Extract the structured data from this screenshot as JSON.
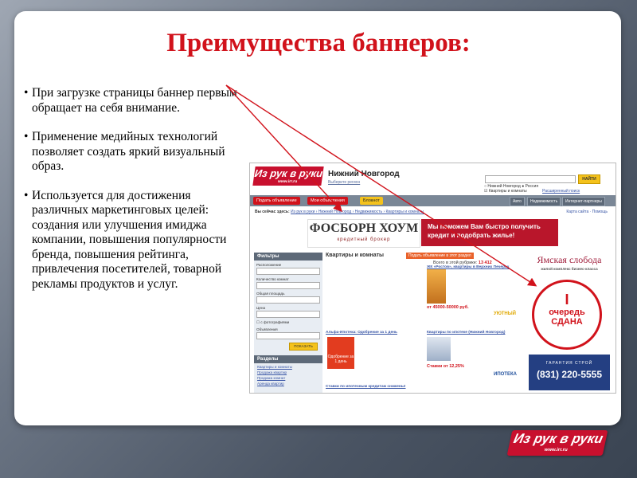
{
  "slide": {
    "title": "Преимущества баннеров:",
    "bullets": [
      {
        "marker": "•",
        "text": "При загрузке страницы баннер первым обращает на себя внимание."
      },
      {
        "marker": "•",
        "text": "Применение медийных технологий позволяет создать яркий визуальный образ."
      },
      {
        "marker": "•",
        "text": "Используется для достижения различных маркетинговых целей: создания или улучшения имиджа компании, повышения популярности бренда, повышения рейтинга, привлечения посетителей, товарной рекламы продуктов и услуг."
      }
    ],
    "footer_logo": {
      "text": "Из рук в руки",
      "url": "www.irr.ru"
    },
    "arrow_color": "#d1121b"
  },
  "screenshot": {
    "logo": {
      "text": "Из рук в руки",
      "url": "www.irr.ru"
    },
    "city": "Нижний Новгород",
    "city_change": "Выберите регион",
    "search": {
      "button": "НАЙТИ",
      "options": [
        "Нижний Новгород",
        "Россия",
        "Квартиры и комнаты"
      ],
      "advanced": "Расширенный поиск"
    },
    "nav": {
      "tabs": [
        "Подать объявление",
        "Мои объявления",
        "Блокнот"
      ],
      "right": [
        "Авто",
        "Недвижимость",
        "Интернет-партнеры"
      ]
    },
    "breadcrumb": {
      "prefix": "Вы сейчас здесь:",
      "path": "Из рук в руки › Нижний Новгород › Недвижимость › Квартиры и комнаты"
    },
    "top_links": "Карта сайта · Помощь",
    "banner_fosborn": {
      "name": "ФОСБОРН ХОУМ",
      "sub": "кредитный брокер"
    },
    "banner_red": "Мы поможем Вам быстро получить кредит и подобрать жилье!",
    "sidebar": {
      "filters_title": "Фильтры",
      "labels": [
        "Расположение",
        "Количество комнат",
        "Общая площадь",
        "Цена",
        "с фотографиями",
        "Объявления"
      ],
      "button": "ПОКАЗАТЬ",
      "sections_title": "Разделы",
      "links": [
        "Квартиры и комнаты",
        "Продажа квартир",
        "Продажа комнат",
        "Аренда квартир"
      ]
    },
    "main": {
      "heading": "Квартиры и комнаты",
      "chip": "Подать объявление в этот раздел",
      "count_label": "Всего в этой рубрике:",
      "count_value": "13 412",
      "listings": [
        {
          "title": "ЖК «Ростов», квартиры в Верхних Печерах",
          "price": "от 45000-50000 руб."
        },
        {
          "title": "Альфа-Ипотека: Одобрение за 1 день",
          "text": "Одобрение за 1 день"
        },
        {
          "title": "Квартиры по ипотеке (Нижний Новгород)",
          "price": "Ставки от 12,25%"
        },
        {
          "title": "Ставки по ипотечным кредитам снижены!"
        }
      ],
      "brand": "ИПОТЕКА",
      "partner": "УЮТНЫЙ"
    },
    "right_banner": {
      "name": "Ямская слобода",
      "subtitle": "жилой комплекс бизнес-класса",
      "stamp": [
        "I",
        "очередь",
        "СДАНА"
      ],
      "brand": "ГАРАНТИЯ СТРОЙ",
      "phone": "(831) 220-5555"
    }
  }
}
